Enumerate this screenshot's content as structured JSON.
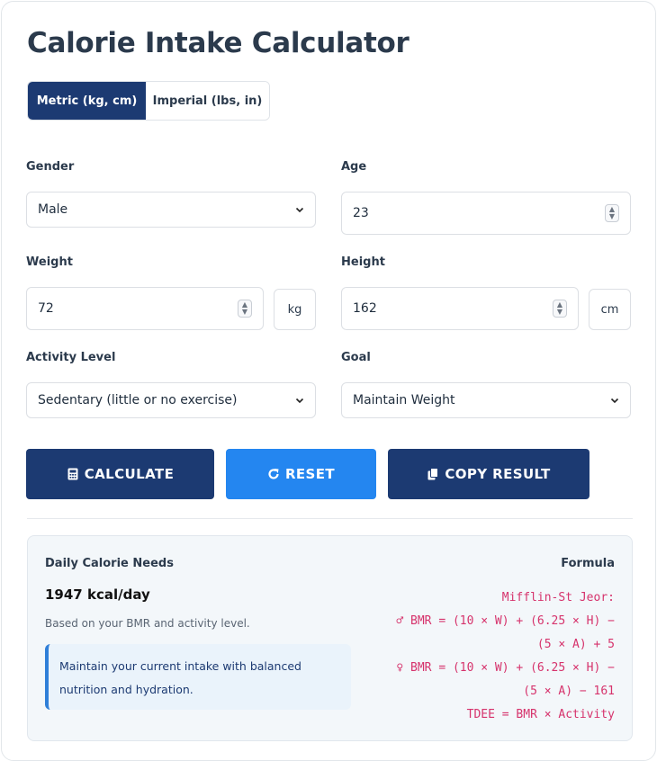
{
  "title": "Calorie Intake Calculator",
  "unit_toggle": {
    "metric_label": "Metric (kg, cm)",
    "imperial_label": "Imperial (lbs, in)",
    "selected": "metric"
  },
  "form": {
    "gender": {
      "label": "Gender",
      "value": "Male"
    },
    "age": {
      "label": "Age",
      "value": "23"
    },
    "weight": {
      "label": "Weight",
      "value": "72",
      "unit": "kg"
    },
    "height": {
      "label": "Height",
      "value": "162",
      "unit": "cm"
    },
    "activity": {
      "label": "Activity Level",
      "value": "Sedentary (little or no exercise)"
    },
    "goal": {
      "label": "Goal",
      "value": "Maintain Weight"
    }
  },
  "buttons": {
    "calculate": "CALCULATE",
    "reset": "RESET",
    "copy": "COPY RESULT"
  },
  "result": {
    "label": "Daily Calorie Needs",
    "value": "1947 kcal/day",
    "subtext": "Based on your BMR and activity level.",
    "note": "Maintain your current intake with balanced nutrition and hydration.",
    "formula_label": "Formula",
    "formula_lines": [
      "Mifflin-St Jeor:",
      "♂ BMR = (10 × W) + (6.25 × H) −",
      "(5 × A) + 5",
      "♀ BMR = (10 × W) + (6.25 × H) −",
      "(5 × A) − 161",
      "TDEE = BMR × Activity"
    ]
  },
  "colors": {
    "primary": "#1c3a72",
    "accent_blue": "#2486f0",
    "formula": "#d6336c"
  },
  "icons": {
    "calculate": "calculator-icon",
    "reset": "redo-icon",
    "copy": "copy-icon"
  }
}
